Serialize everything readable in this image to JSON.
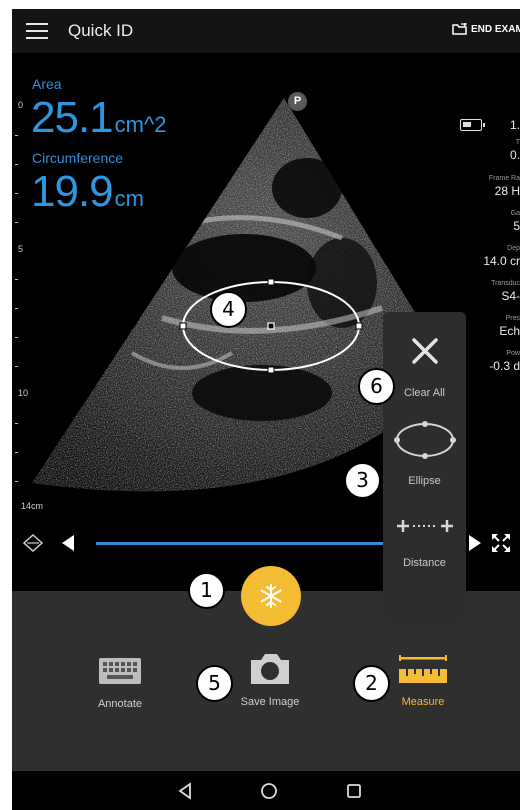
{
  "app": {
    "title": "Quick ID",
    "end_exam": "END EXAM"
  },
  "depth_scale": {
    "marks": [
      "0",
      "5",
      "10"
    ],
    "bottom": "14cm"
  },
  "measurements": {
    "area": {
      "label": "Area",
      "value": "25.1",
      "unit": "cm^2"
    },
    "circumference": {
      "label": "Circumference",
      "value": "19.9",
      "unit": "cm"
    }
  },
  "probe_badge": "P",
  "params": [
    {
      "label": "",
      "value": "1."
    },
    {
      "label": "T",
      "value": "0."
    },
    {
      "label": "Frame Ra",
      "value": "28 H"
    },
    {
      "label": "Ga",
      "value": "5"
    },
    {
      "label": "Dep",
      "value": "14.0 cr"
    },
    {
      "label": "Transduc",
      "value": "S4-"
    },
    {
      "label": "Pres",
      "value": "Ech"
    },
    {
      "label": "Pow",
      "value": "-0.3 d"
    }
  ],
  "tools_menu": {
    "clear_all": "Clear All",
    "ellipse": "Ellipse",
    "distance": "Distance"
  },
  "bottom_bar": {
    "annotate": "Annotate",
    "save_image": "Save Image",
    "measure": "Measure"
  },
  "callouts": [
    "1",
    "2",
    "3",
    "4",
    "5",
    "6"
  ],
  "colors": {
    "accent_blue": "#2e95de",
    "freeze_yellow": "#f4bb34",
    "measure_active": "#f4bb34"
  }
}
